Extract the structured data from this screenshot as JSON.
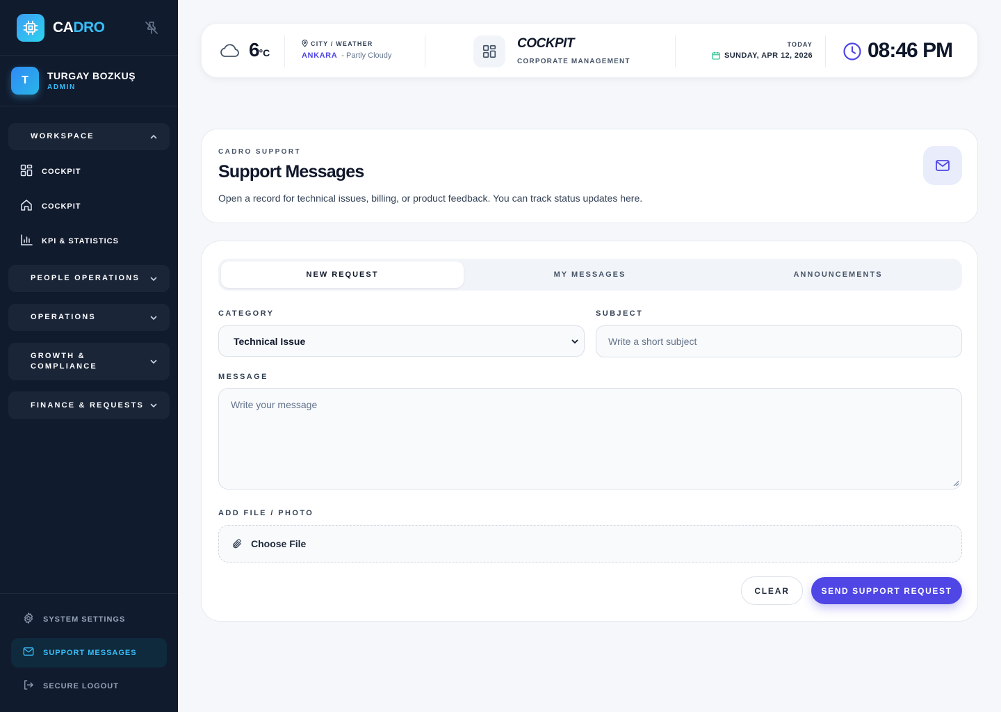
{
  "brand": {
    "part1": "CA",
    "part2": "DRO"
  },
  "user": {
    "initial": "T",
    "name": "TURGAY BOZKUŞ",
    "role": "ADMIN"
  },
  "sidebar": {
    "workspace": {
      "label": "WORKSPACE",
      "items": [
        {
          "label": "COCKPIT",
          "icon": "grid-icon"
        },
        {
          "label": "COCKPIT",
          "icon": "home-icon"
        },
        {
          "label": "KPI & STATISTICS",
          "icon": "bar-chart-icon"
        }
      ]
    },
    "groups": [
      {
        "label": "PEOPLE OPERATIONS"
      },
      {
        "label": "OPERATIONS"
      },
      {
        "label_line1": "GROWTH &",
        "label_line2": "COMPLIANCE"
      },
      {
        "label": "FINANCE & REQUESTS"
      }
    ],
    "bottom": [
      {
        "label": "SYSTEM SETTINGS",
        "icon": "gear-icon"
      },
      {
        "label": "SUPPORT MESSAGES",
        "icon": "mail-icon",
        "active": true
      },
      {
        "label": "SECURE LOGOUT",
        "icon": "logout-icon"
      }
    ]
  },
  "topbar": {
    "temperature": "6",
    "temperature_unit": "°C",
    "weather_label": "CITY / WEATHER",
    "city": "ANKARA",
    "weather": "- Partly Cloudy",
    "app_title": "COCKPIT",
    "app_subtitle": "CORPORATE MANAGEMENT",
    "today_label": "TODAY",
    "date": "SUNDAY, APR 12, 2026",
    "time": "08:46 PM"
  },
  "header": {
    "eyebrow": "CADRO SUPPORT",
    "title": "Support Messages",
    "description": "Open a record for technical issues, billing, or product feedback. You can track status updates here."
  },
  "tabs": [
    "NEW REQUEST",
    "MY MESSAGES",
    "ANNOUNCEMENTS"
  ],
  "form": {
    "category_label": "CATEGORY",
    "category_value": "Technical Issue",
    "subject_label": "SUBJECT",
    "subject_placeholder": "Write a short subject",
    "message_label": "MESSAGE",
    "message_placeholder": "Write your message",
    "file_label": "ADD FILE / PHOTO",
    "file_button": "Choose File",
    "clear_label": "CLEAR",
    "send_label": "SEND SUPPORT REQUEST"
  },
  "colors": {
    "sidebar_bg": "#111b2e",
    "accent": "#4f46e5",
    "brand_cyan": "#38bdf8",
    "page_bg": "#f5f7fa"
  }
}
